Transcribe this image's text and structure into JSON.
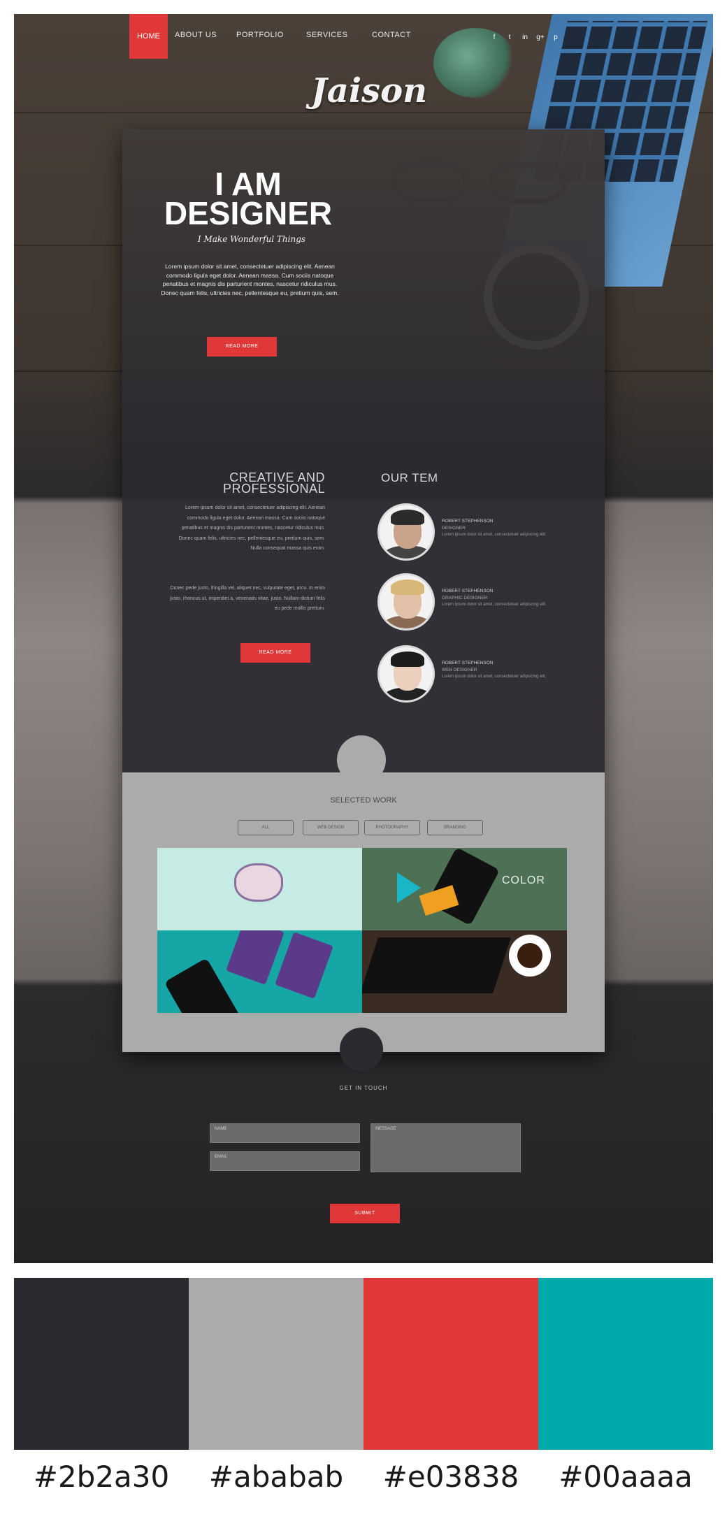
{
  "nav": {
    "items": [
      "HOME",
      "ABOUT US",
      "PORTFOLIO",
      "SERVICES",
      "CONTACT"
    ],
    "social": [
      "f",
      "t",
      "in",
      "g+",
      "p"
    ]
  },
  "brand": {
    "logo": "Jaison"
  },
  "hero": {
    "title_line1": "I AM",
    "title_line2": "DESIGNER",
    "subtitle": "I Make Wonderful Things",
    "body": "Lorem ipsum dolor sit amet, consectetuer adipiscing elit. Aenean commodo ligula eget dolor. Aenean massa. Cum sociis natoque penatibus et magnis dis parturient montes, nascetur ridiculus mus. Donec quam felis, ultricies nec, pellentesque eu, pretium quis, sem.",
    "button": "READ MORE"
  },
  "about": {
    "title_line1": "CREATIVE AND",
    "title_line2": "PROFESSIONAL",
    "para1": "Lorem ipsum dolor sit amet, consectetuer adipiscing elit. Aenean commodo ligula eget dolor. Aenean massa. Cum sociis natoque penatibus et magnis dis parturient montes, nascetur ridiculus mus. Donec quam felis, ultricies nec, pellentesque eu, pretium quis, sem. Nulla consequat massa quis enim.",
    "para2": "Donec pede justo, fringilla vel, aliquet nec, vulputate eget, arcu. In enim justo, rhoncus ut, imperdiet a, venenatis vitae, justo. Nullam dictum felis eu pede mollis pretium.",
    "button": "READ MORE"
  },
  "team": {
    "title": "OUR TEM",
    "members": [
      {
        "name": "ROBERT STEPHENSON",
        "role": "DESIGNER",
        "desc": "Lorem ipsum dolor sit amet, consectetuer adipiscing elit."
      },
      {
        "name": "ROBERT STEPHENSON",
        "role": "GRAPHIC DESIGNER",
        "desc": "Lorem ipsum dolor sit amet, consectetuer adipiscing elit."
      },
      {
        "name": "ROBERT STEPHENSON",
        "role": "WEB DESIGNER",
        "desc": "Lorem ipsum dolor sit amet, consectetuer adipiscing elit."
      }
    ]
  },
  "work": {
    "title": "SELECTED WORK",
    "filters": [
      "ALL",
      "WEB DESIGN",
      "PHOTOGRAPHY",
      "BRANDING"
    ],
    "tiles": [
      "",
      "COLOR",
      "",
      ""
    ]
  },
  "contact": {
    "title": "GET IN TOUCH",
    "name_placeholder": "NAME",
    "email_placeholder": "EMAIL",
    "message_placeholder": "MESSAGE",
    "button": "SUBMIT"
  },
  "palette": {
    "colors": [
      "#2b2a30",
      "#ababab",
      "#e03838",
      "#00aaaa"
    ],
    "labels": [
      "#2b2a30",
      "#ababab",
      "#e03838",
      "#00aaaa"
    ]
  }
}
